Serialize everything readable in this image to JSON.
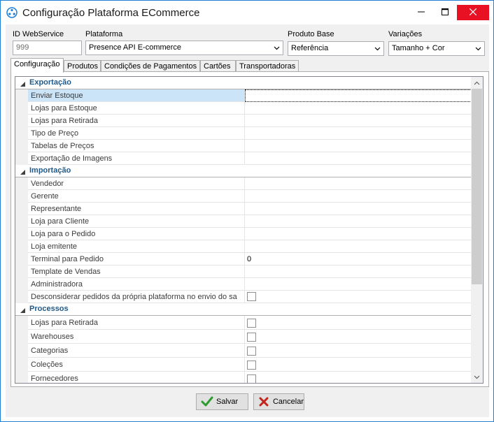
{
  "window": {
    "title": "Configuração Plataforma ECommerce",
    "accent": "#1e7fd6",
    "close_color": "#e81123"
  },
  "header": {
    "id_label": "ID WebService",
    "id_value": "999",
    "plataforma_label": "Plataforma",
    "plataforma_value": "Presence API E-commerce",
    "produto_base_label": "Produto Base",
    "produto_base_value": "Referência",
    "variacoes_label": "Variações",
    "variacoes_value": "Tamanho + Cor"
  },
  "tabs": [
    {
      "label": "Configuração",
      "active": true
    },
    {
      "label": "Produtos"
    },
    {
      "label": "Condições de Pagamentos"
    },
    {
      "label": "Cartões"
    },
    {
      "label": "Transportadoras"
    }
  ],
  "grid": {
    "categories": [
      {
        "label": "Exportação",
        "items": [
          {
            "name": "Enviar Estoque",
            "value": "",
            "selected": true
          },
          {
            "name": "Lojas para Estoque",
            "value": ""
          },
          {
            "name": "Lojas para Retirada",
            "value": ""
          },
          {
            "name": "Tipo de Preço",
            "value": ""
          },
          {
            "name": "Tabelas de Preços",
            "value": ""
          },
          {
            "name": "Exportação de Imagens",
            "value": ""
          }
        ]
      },
      {
        "label": "Importação",
        "items": [
          {
            "name": "Vendedor",
            "value": ""
          },
          {
            "name": "Gerente",
            "value": ""
          },
          {
            "name": "Representante",
            "value": ""
          },
          {
            "name": "Loja para Cliente",
            "value": ""
          },
          {
            "name": "Loja para o Pedido",
            "value": ""
          },
          {
            "name": "Loja emitente",
            "value": ""
          },
          {
            "name": "Terminal para Pedido",
            "value": "0"
          },
          {
            "name": "Template de Vendas",
            "value": ""
          },
          {
            "name": "Administradora",
            "value": ""
          },
          {
            "name": "Desconsiderar pedidos da própria plataforma no envio do sa",
            "value": "",
            "checkbox": true
          }
        ]
      },
      {
        "label": "Processos",
        "items": [
          {
            "name": "Lojas para Retirada",
            "value": "",
            "checkbox": true
          },
          {
            "name": "Warehouses",
            "value": "",
            "checkbox": true
          },
          {
            "name": "Categorias",
            "value": "",
            "checkbox": true
          },
          {
            "name": "Coleções",
            "value": "",
            "checkbox": true
          },
          {
            "name": "Fornecedores",
            "value": "",
            "checkbox": true
          }
        ]
      }
    ]
  },
  "footer": {
    "save_label": "Salvar",
    "cancel_label": "Cancelar",
    "save_icon": "checkmark-icon",
    "cancel_icon": "x-icon",
    "save_icon_color": "#2e9b2e",
    "cancel_icon_color": "#c0261c"
  }
}
